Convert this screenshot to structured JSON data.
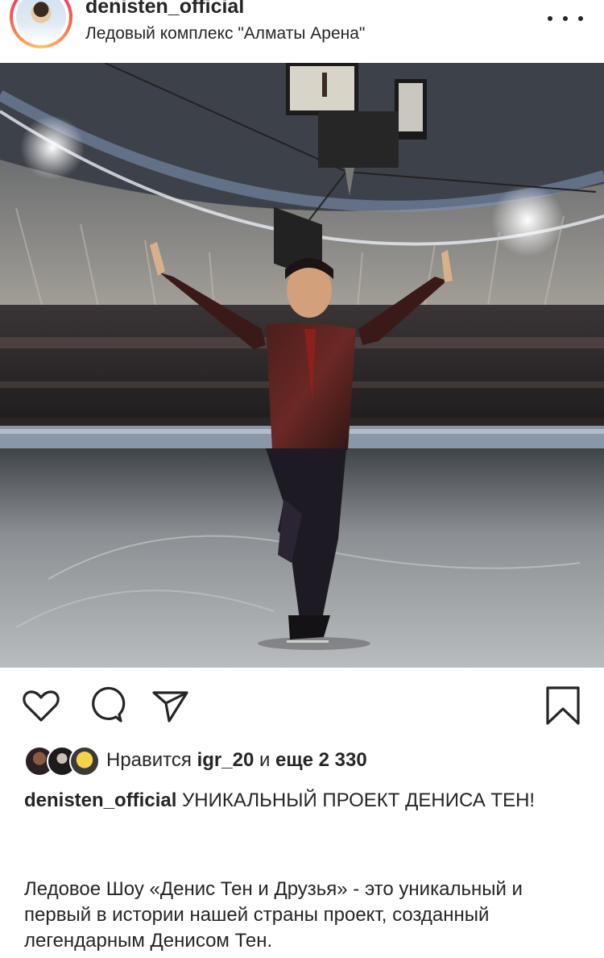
{
  "post": {
    "username": "denisten_official",
    "location": "Ледовый комплекс \"Алматы Арена\""
  },
  "likes": {
    "prefix": "Нравится",
    "user": "igr_20",
    "connector": "и",
    "count_text": "еще 2 330"
  },
  "caption": {
    "username": "denisten_official",
    "title": "УНИКАЛЬНЫЙ ПРОЕКТ ДЕНИСА ТЕН!",
    "description": "Ледовое Шоу «Денис Тен и Друзья» - это уникальный и первый в истории нашей страны проект, созданный легендарным Денисом Тен."
  },
  "icons": {
    "more": "more-dots-icon",
    "like": "heart-icon",
    "comment": "comment-bubble-icon",
    "share": "paper-plane-icon",
    "save": "bookmark-icon"
  },
  "colors": {
    "text": "#262626",
    "story_ring_start": "#d6249f",
    "story_ring_end": "#fdc468"
  }
}
